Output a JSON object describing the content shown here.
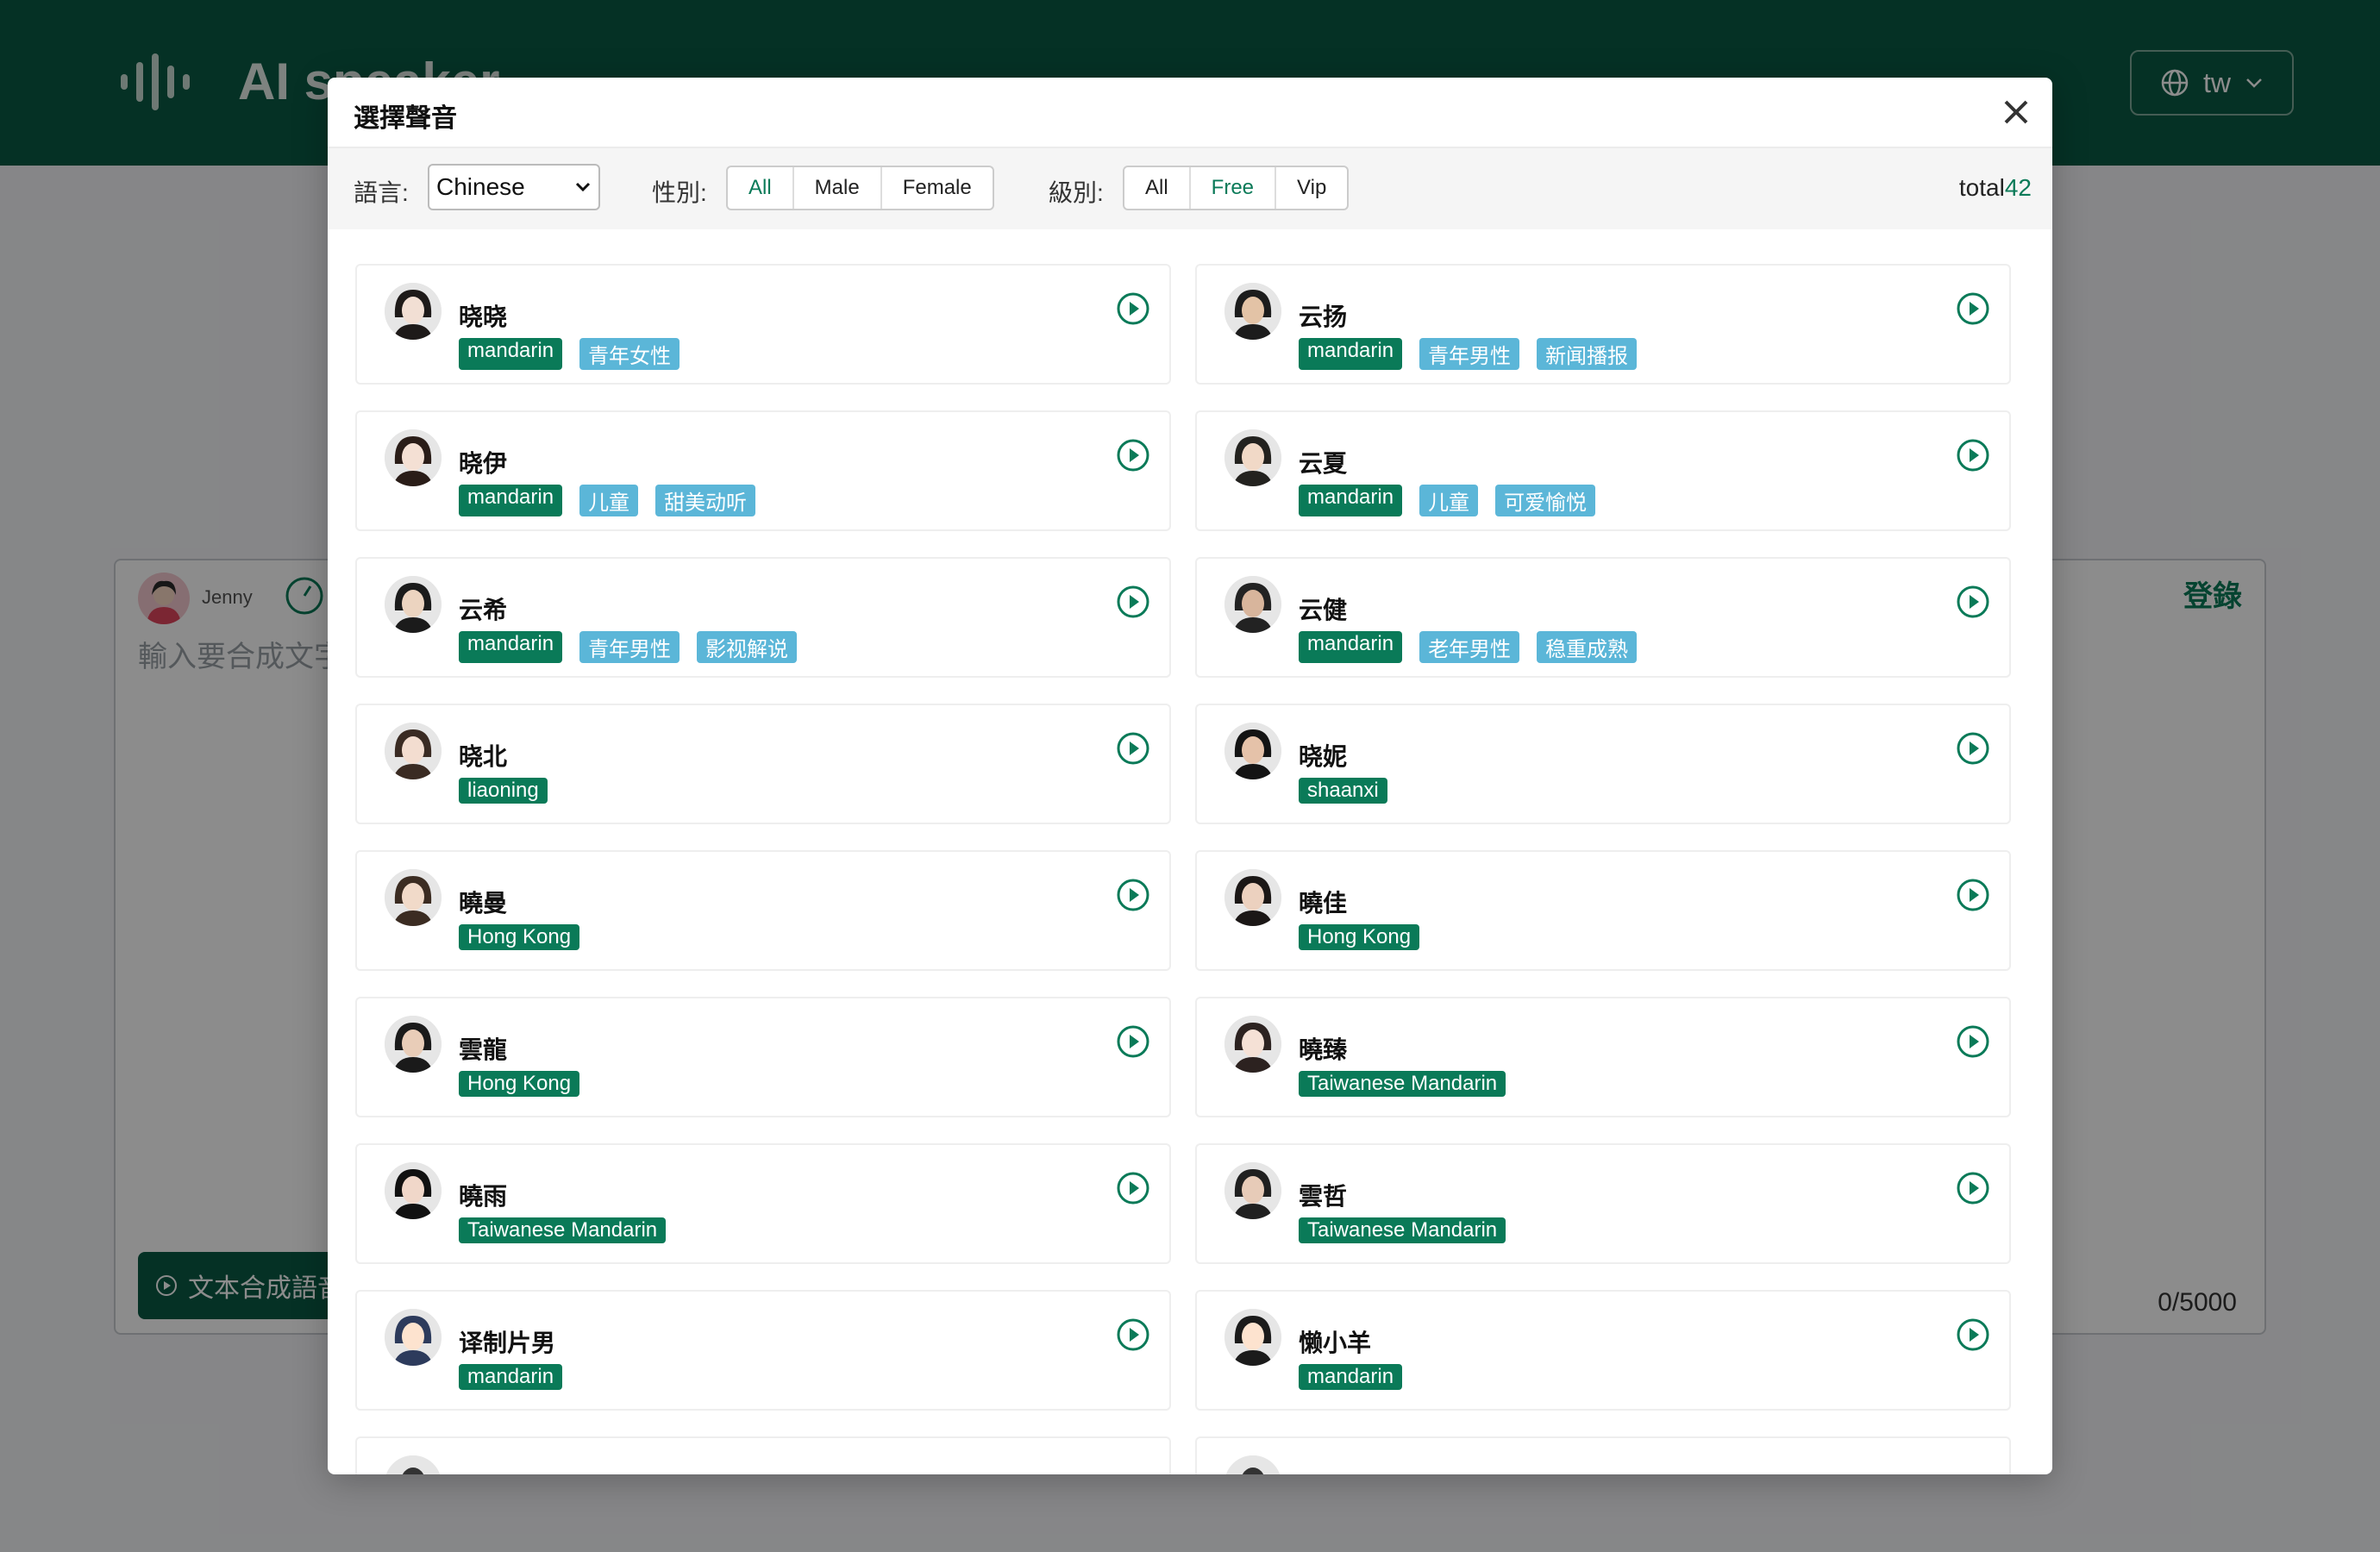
{
  "app": {
    "title": "AI speaker",
    "lang_button": "tw"
  },
  "editor": {
    "current_speaker": "Jenny",
    "placeholder": "輸入要合成文字",
    "login_label": "登錄",
    "synth_button": "文本合成語音",
    "counter": "0/5000"
  },
  "modal": {
    "title": "選擇聲音",
    "language_label": "語言:",
    "language_value": "Chinese",
    "gender_label": "性別:",
    "gender_options": [
      "All",
      "Male",
      "Female"
    ],
    "gender_selected": "All",
    "level_label": "級別:",
    "level_options": [
      "All",
      "Free",
      "Vip"
    ],
    "level_selected": "Free",
    "total_label": "total",
    "total_value": "42"
  },
  "voices": [
    {
      "name": "晓晓",
      "tags": [
        "mandarin",
        "青年女性"
      ],
      "avatar": "female-1"
    },
    {
      "name": "云扬",
      "tags": [
        "mandarin",
        "青年男性",
        "新闻播报"
      ],
      "avatar": "male-suit"
    },
    {
      "name": "晓伊",
      "tags": [
        "mandarin",
        "儿童",
        "甜美动听"
      ],
      "avatar": "female-2"
    },
    {
      "name": "云夏",
      "tags": [
        "mandarin",
        "儿童",
        "可爱愉悦"
      ],
      "avatar": "child-boy"
    },
    {
      "name": "云希",
      "tags": [
        "mandarin",
        "青年男性",
        "影视解说"
      ],
      "avatar": "male-1"
    },
    {
      "name": "云健",
      "tags": [
        "mandarin",
        "老年男性",
        "稳重成熟"
      ],
      "avatar": "male-old"
    },
    {
      "name": "晓北",
      "tags": [
        "liaoning"
      ],
      "avatar": "female-3"
    },
    {
      "name": "晓妮",
      "tags": [
        "shaanxi"
      ],
      "avatar": "female-4"
    },
    {
      "name": "曉曼",
      "tags": [
        "Hong Kong"
      ],
      "avatar": "female-5"
    },
    {
      "name": "曉佳",
      "tags": [
        "Hong Kong"
      ],
      "avatar": "female-6"
    },
    {
      "name": "雲龍",
      "tags": [
        "Hong Kong"
      ],
      "avatar": "male-2"
    },
    {
      "name": "曉臻",
      "tags": [
        "Taiwanese Mandarin"
      ],
      "avatar": "female-7"
    },
    {
      "name": "曉雨",
      "tags": [
        "Taiwanese Mandarin"
      ],
      "avatar": "female-8"
    },
    {
      "name": "雲哲",
      "tags": [
        "Taiwanese Mandarin"
      ],
      "avatar": "male-3"
    },
    {
      "name": "译制片男",
      "tags": [
        "mandarin"
      ],
      "avatar": "cartoon-man"
    },
    {
      "name": "懒小羊",
      "tags": [
        "mandarin"
      ],
      "avatar": "cartoon-girl"
    }
  ],
  "colors": {
    "brand": "#0a5a44",
    "accent": "#0a7a58",
    "tag_secondary": "#5bb6d8"
  }
}
